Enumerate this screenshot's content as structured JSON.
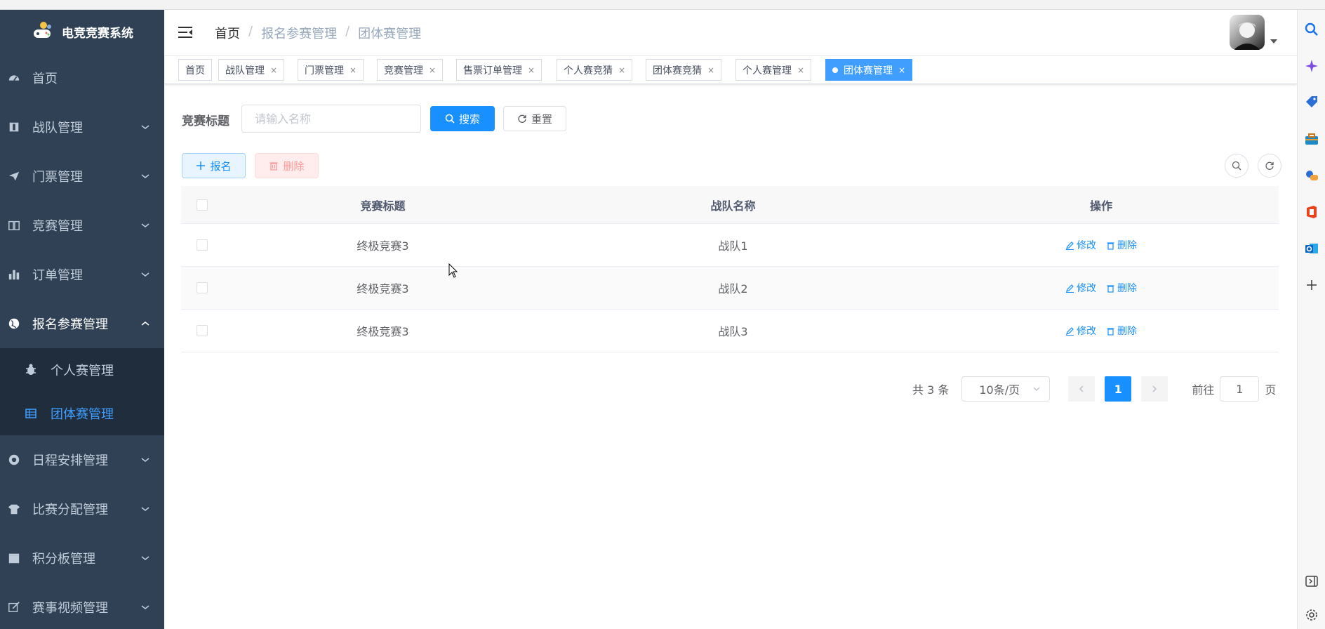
{
  "app": {
    "title": "电竞竞赛系统"
  },
  "sidebar": {
    "items": [
      {
        "label": "首页",
        "icon": "dashboard-icon"
      },
      {
        "label": "战队管理",
        "icon": "education-icon"
      },
      {
        "label": "门票管理",
        "icon": "paper-plane-icon"
      },
      {
        "label": "竞赛管理",
        "icon": "book-icon"
      },
      {
        "label": "订单管理",
        "icon": "bar-chart-icon"
      },
      {
        "label": "报名参赛管理",
        "icon": "globe-icon"
      },
      {
        "label": "日程安排管理",
        "icon": "lifebuoy-icon"
      },
      {
        "label": "比赛分配管理",
        "icon": "tshirt-icon"
      },
      {
        "label": "积分板管理",
        "icon": "clapperboard-icon"
      },
      {
        "label": "赛事视频管理",
        "icon": "edit-icon"
      }
    ],
    "submenu": [
      {
        "label": "个人赛管理",
        "icon": "bug-icon"
      },
      {
        "label": "团体赛管理",
        "icon": "table-icon"
      }
    ]
  },
  "breadcrumb": {
    "home": "首页",
    "level1": "报名参赛管理",
    "current": "团体赛管理",
    "separator": "/"
  },
  "tags": [
    {
      "label": "首页",
      "closable": false
    },
    {
      "label": "战队管理",
      "closable": true
    },
    {
      "label": "门票管理",
      "closable": true
    },
    {
      "label": "竞赛管理",
      "closable": true
    },
    {
      "label": "售票订单管理",
      "closable": true
    },
    {
      "label": "个人赛竞猜",
      "closable": true
    },
    {
      "label": "团体赛竞猜",
      "closable": true
    },
    {
      "label": "个人赛管理",
      "closable": true
    },
    {
      "label": "团体赛管理",
      "closable": true,
      "active": true
    }
  ],
  "tag_close_glyph": "×",
  "search": {
    "label": "竞赛标题",
    "placeholder": "请输入名称",
    "search_button": "搜索",
    "reset_button": "重置"
  },
  "toolbar": {
    "add_button": "报名",
    "delete_button": "删除"
  },
  "table": {
    "columns": [
      "竞赛标题",
      "战队名称",
      "操作"
    ],
    "rows": [
      {
        "title": "终极竞赛3",
        "team": "战队1"
      },
      {
        "title": "终极竞赛3",
        "team": "战队2"
      },
      {
        "title": "终极竞赛3",
        "team": "战队3"
      }
    ],
    "edit_label": "修改",
    "delete_label": "删除"
  },
  "pagination": {
    "total_text": "共 3 条",
    "page_size": "10条/页",
    "current_page": "1",
    "goto_prefix": "前往",
    "goto_value": "1",
    "goto_suffix": "页"
  },
  "colors": {
    "sidebar_bg": "#304156",
    "submenu_bg": "#1f2d3d",
    "primary": "#1890ff",
    "active_tag": "#409eff"
  }
}
